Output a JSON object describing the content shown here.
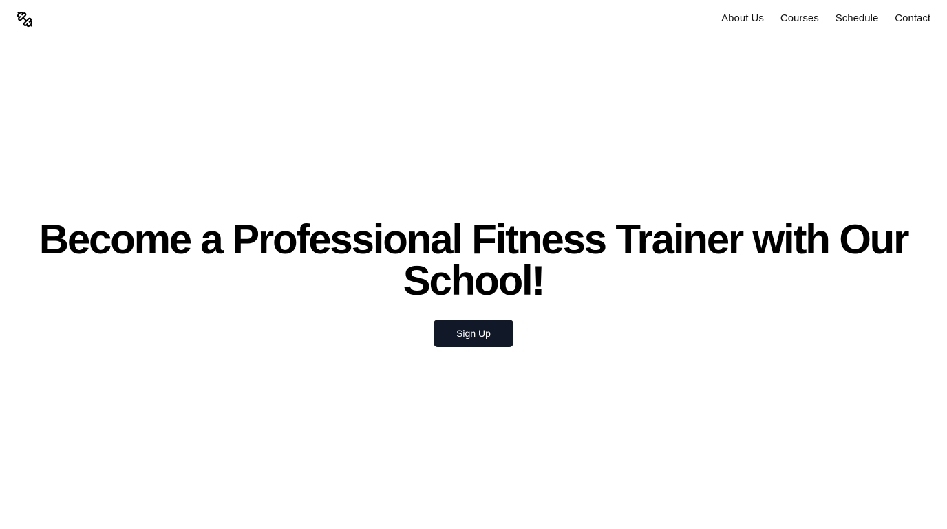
{
  "header": {
    "logo_icon": "dumbbell-icon",
    "nav": [
      {
        "label": "About Us"
      },
      {
        "label": "Courses"
      },
      {
        "label": "Schedule"
      },
      {
        "label": "Contact"
      }
    ]
  },
  "hero": {
    "title": "Become a Professional Fitness Trainer with Our School!",
    "cta_label": "Sign Up"
  },
  "colors": {
    "background": "#ffffff",
    "text": "#000000",
    "button_bg": "#111827",
    "button_text": "#ffffff"
  }
}
